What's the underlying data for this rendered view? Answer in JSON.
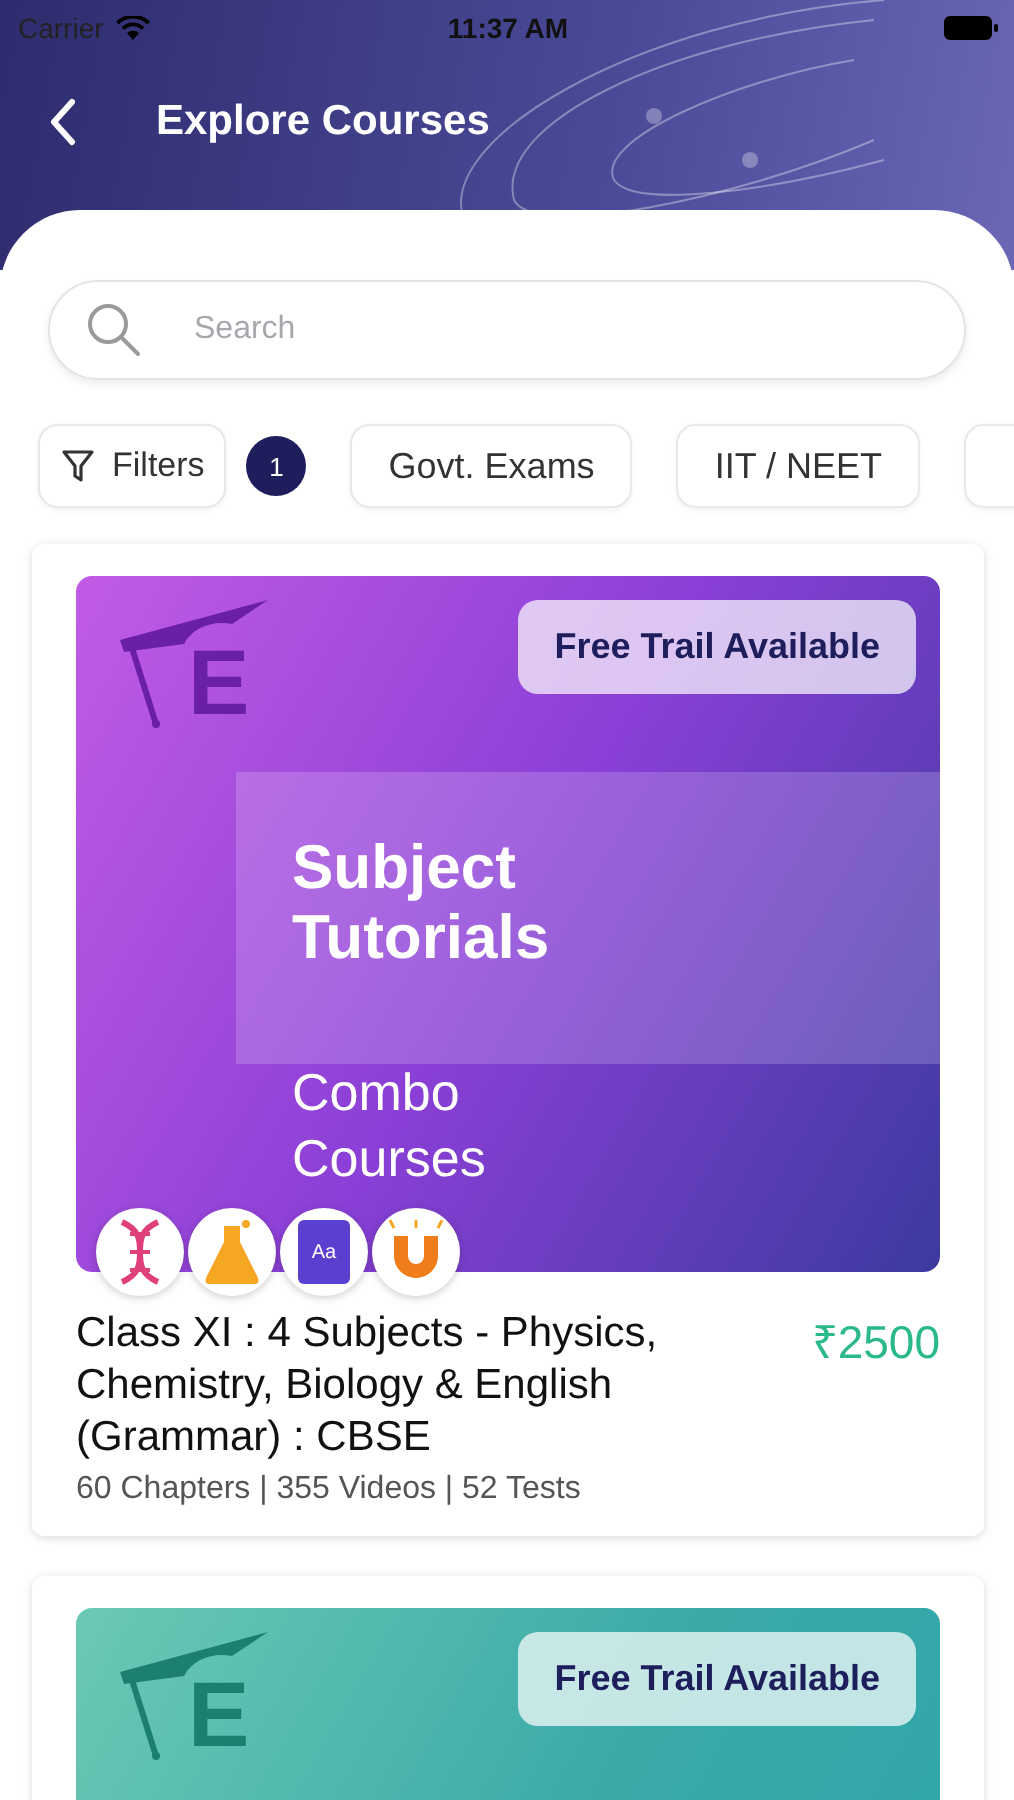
{
  "status_bar": {
    "carrier": "Carrier",
    "time": "11:37 AM"
  },
  "header": {
    "title": "Explore Courses"
  },
  "search": {
    "placeholder": "Search"
  },
  "filters": {
    "label": "Filters",
    "count": "1"
  },
  "chips": [
    {
      "label": "Govt. Exams"
    },
    {
      "label": "IIT / NEET"
    },
    {
      "kind": "clipped"
    }
  ],
  "courses": [
    {
      "color": "#8a3fd6",
      "logo_letter": "E",
      "badge": "Free Trail Available",
      "headline": [
        "Subject",
        "Tutorials"
      ],
      "subline": [
        "Combo",
        "Courses"
      ],
      "subjects": [
        {
          "kind": "dna"
        },
        {
          "kind": "flask"
        },
        {
          "kind": "book",
          "label": "Aa"
        },
        {
          "kind": "magnet"
        }
      ],
      "title": "Class XI : 4 Subjects - Physics, Chemistry, Biology & English (Grammar) : CBSE",
      "price": "₹2500",
      "meta": "60 Chapters | 355 Videos | 52 Tests"
    },
    {
      "color": "#3aaaa8",
      "logo_letter": "E",
      "badge": "Free Trail Available"
    }
  ]
}
